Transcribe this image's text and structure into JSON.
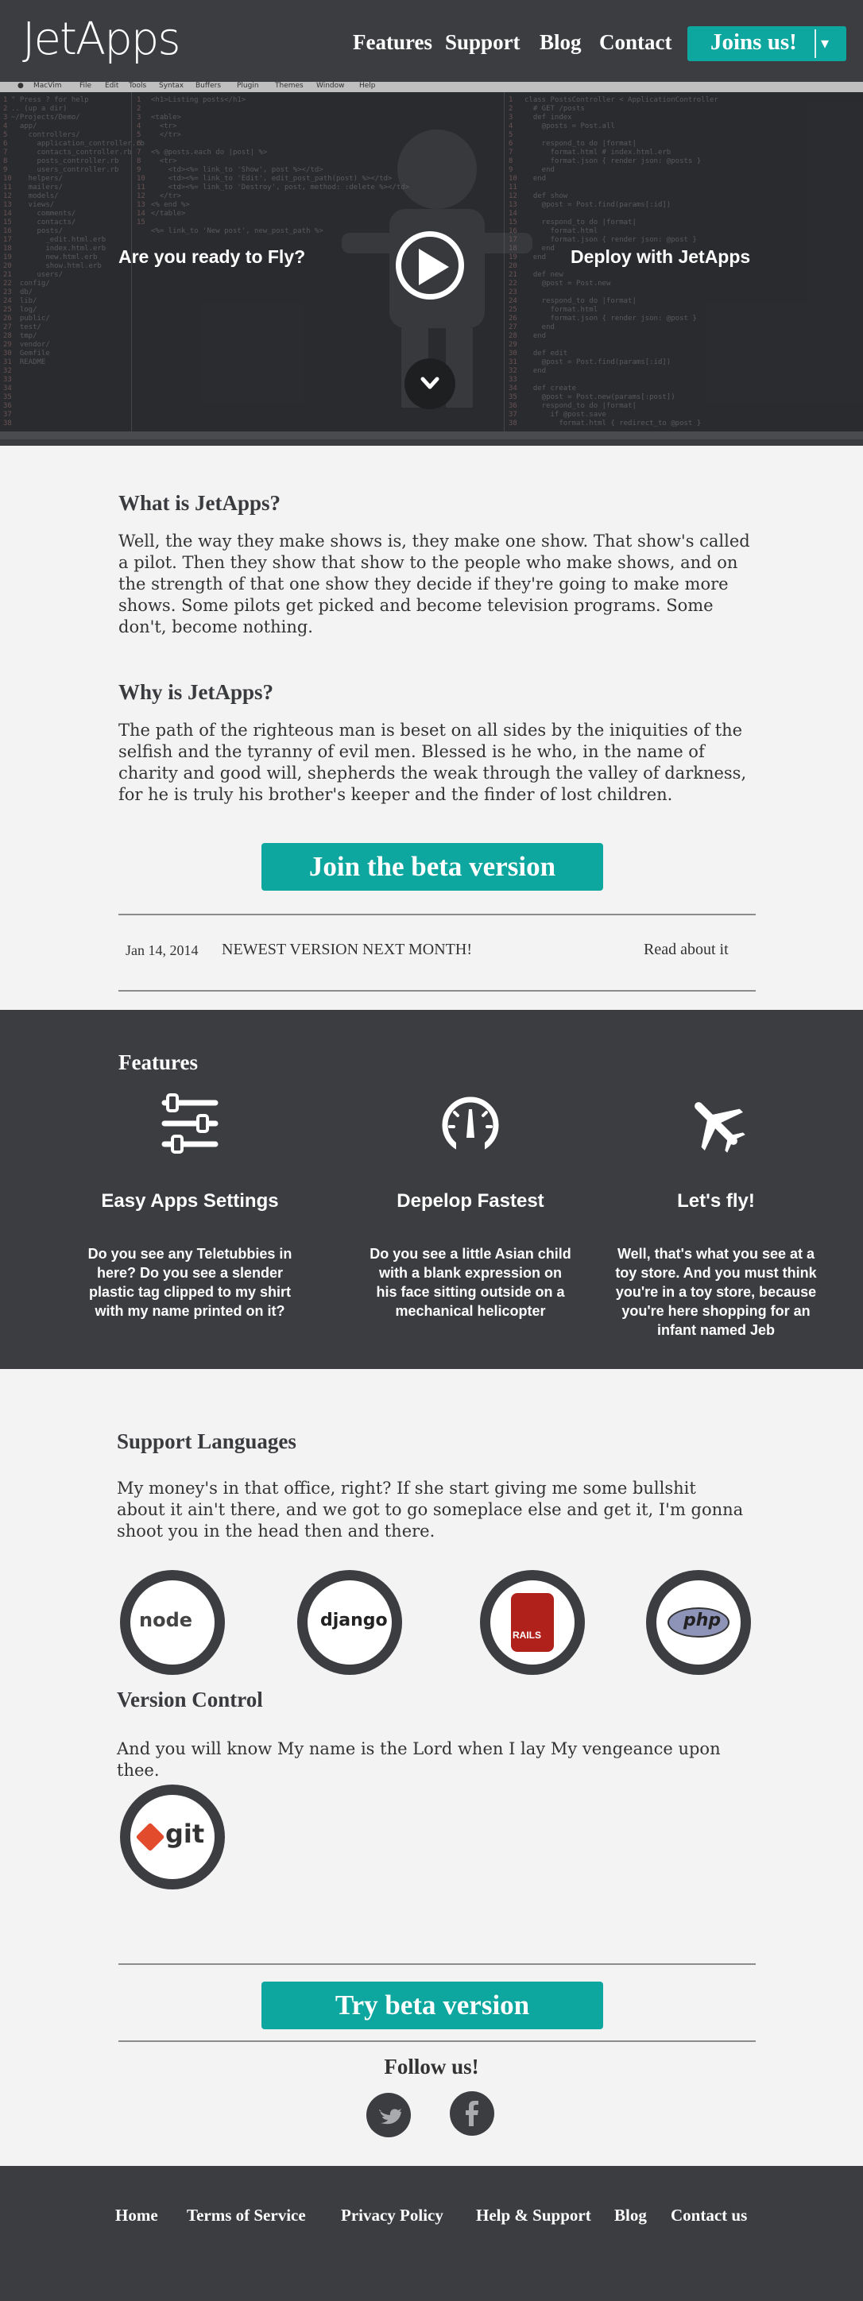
{
  "header": {
    "logo": "JetApps",
    "nav": [
      "Features",
      "Support",
      "Blog",
      "Contact"
    ],
    "cta_label": "Joins us!",
    "cta_caret": "▾"
  },
  "hero": {
    "editor_menu": [
      "MacVim",
      "File",
      "Edit",
      "Tools",
      "Syntax",
      "Buffers",
      "Plugin",
      "Themes",
      "Window",
      "Help"
    ],
    "left_text": "Are you ready to Fly?",
    "right_text": "Deploy with JetApps"
  },
  "about": {
    "what_title": "What is JetApps?",
    "what_text": "Well, the way they make shows is, they make one show. That show's called a pilot. Then they show that show to the people who make shows, and on the strength of that one show they decide if they're going to make more shows. Some pilots get picked and become television programs. Some don't, become nothing.",
    "why_title": "Why is JetApps?",
    "why_text": "The path of the righteous man is beset on all sides by the iniquities of the selfish and the tyranny of evil men. Blessed is he who, in the name of charity and good will, shepherds the weak through the valley of darkness, for he is truly his brother's keeper and the finder of lost children.",
    "beta_button": "Join the beta version"
  },
  "news": {
    "date": "Jan 14, 2014",
    "title": "NEWEST VERSION NEXT MONTH!",
    "link": "Read about it"
  },
  "features": {
    "title": "Features",
    "items": [
      {
        "icon": "sliders-icon",
        "name": "Easy Apps Settings",
        "desc": "Do you see any Teletubbies in here? Do you see a slender plastic tag clipped to my shirt with my name printed on it?"
      },
      {
        "icon": "speedometer-icon",
        "name": "Depelop Fastest",
        "desc": "Do you see a little Asian child with a blank expression on his face sitting outside on a mechanical helicopter"
      },
      {
        "icon": "airplane-icon",
        "name": "Let's fly!",
        "desc": "Well, that's what you see at a toy store. And you must think you're in a toy store, because you're here shopping for an infant named Jeb"
      }
    ]
  },
  "support": {
    "title": "Support Languages",
    "text": "My money's in that office, right? If she start giving me some bullshit about it ain't there, and we got to go someplace else and get it, I'm gonna shoot you in the head then and there.",
    "languages": [
      "node",
      "django",
      "RAILS",
      "php"
    ],
    "vc_title": "Version Control",
    "vc_text": "And you will know My name is the Lord when I lay My vengeance upon thee.",
    "vc_logo": "git",
    "try_button": "Try beta version"
  },
  "follow": {
    "title": "Follow us!",
    "networks": [
      "twitter-icon",
      "facebook-icon"
    ]
  },
  "footer": {
    "links": [
      "Home",
      "Terms of Service",
      "Privacy Policy",
      "Help & Support",
      "Blog",
      "Contact us"
    ]
  },
  "colors": {
    "dark": "#3c3d41",
    "accent": "#0ea79f",
    "background": "#f3f3f3"
  }
}
